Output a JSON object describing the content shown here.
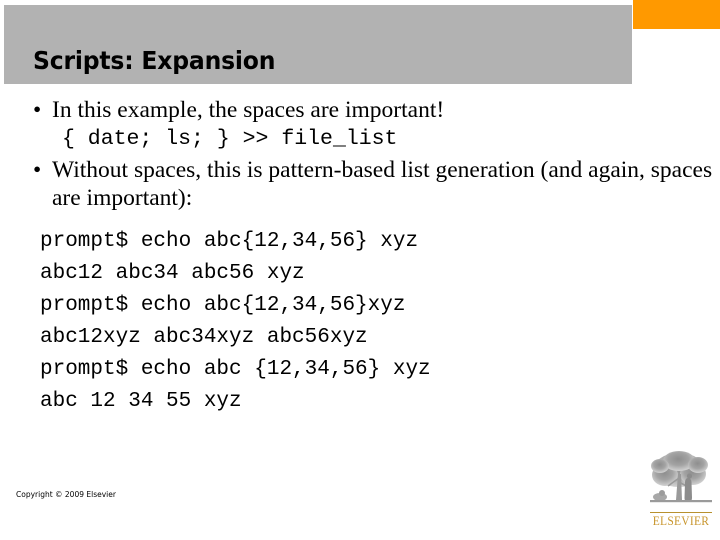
{
  "slide": {
    "title": "Scripts: Expansion",
    "accent_color": "#ff9900",
    "title_band_color": "#b2b2b2",
    "background_color": "#ffffff"
  },
  "body": {
    "bullet_glyph": "•",
    "bullets": [
      {
        "text": "In this example, the spaces are important!",
        "code": "{ date; ls; } >> file_list"
      },
      {
        "text": "Without spaces, this is pattern-based list generation (and again, spaces are important):"
      }
    ],
    "code_block": [
      "prompt$ echo abc{12,34,56} xyz",
      "abc12 abc34 abc56 xyz",
      "prompt$ echo abc{12,34,56}xyz",
      "abc12xyz abc34xyz abc56xyz",
      "prompt$ echo abc {12,34,56} xyz",
      "abc 12 34 55 xyz"
    ]
  },
  "footer": {
    "copyright": "Copyright © 2009 Elsevier"
  },
  "logo": {
    "wordmark": "ELSEVIER",
    "wordmark_color": "#c8962e",
    "tree_color": "#9a9a9a"
  }
}
